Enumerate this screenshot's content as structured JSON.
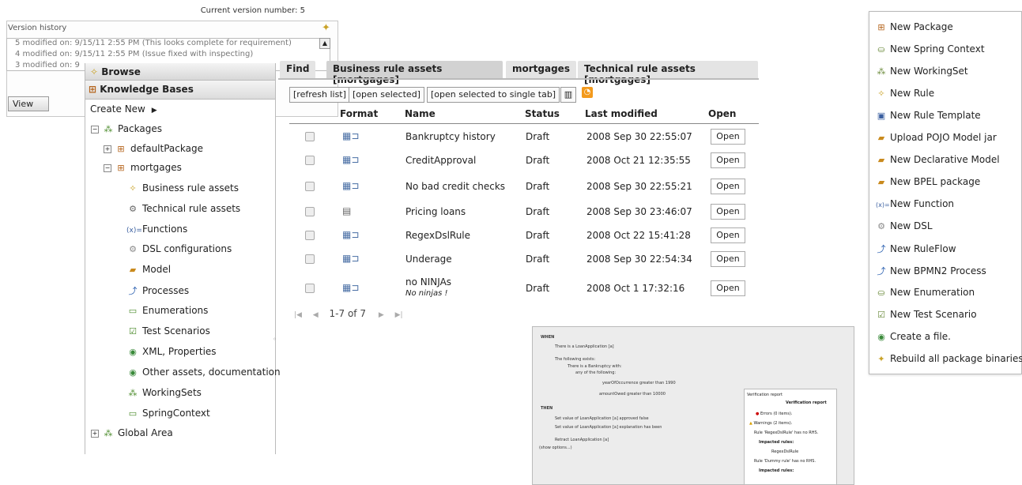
{
  "version_history": {
    "current_label": "Current version number: 5",
    "legend": "Version history",
    "entries": [
      "5 modified on: 9/15/11 2:55 PM (This looks complete for requirement)",
      "4 modified on: 9/15/11 2:55 PM (Issue fixed with inspecting)",
      "3 modified on: 9"
    ],
    "view_label": "View"
  },
  "navigator": {
    "browse_label": "Browse",
    "kb_label": "Knowledge Bases",
    "create_new": "Create New",
    "tree": [
      {
        "label": "Packages"
      },
      {
        "label": "defaultPackage"
      },
      {
        "label": "mortgages"
      },
      {
        "label": "Business rule assets"
      },
      {
        "label": "Technical rule assets"
      },
      {
        "label": "Functions"
      },
      {
        "label": "DSL configurations"
      },
      {
        "label": "Model"
      },
      {
        "label": "Processes"
      },
      {
        "label": "Enumerations"
      },
      {
        "label": "Test Scenarios"
      },
      {
        "label": "XML, Properties"
      },
      {
        "label": "Other assets, documentation"
      },
      {
        "label": "WorkingSets"
      },
      {
        "label": "SpringContext"
      },
      {
        "label": "Global Area"
      }
    ]
  },
  "tabs": [
    {
      "label": "Find"
    },
    {
      "label": "Business rule assets [mortgages]"
    },
    {
      "label": "mortgages"
    },
    {
      "label": "Technical rule assets [mortgages]"
    }
  ],
  "toolbar": {
    "refresh": "[refresh list]",
    "open_selected": "[open selected]",
    "open_single": "[open selected to single tab]"
  },
  "table": {
    "headers": [
      "Format",
      "Name",
      "Status",
      "Last modified",
      "Open"
    ],
    "rows": [
      {
        "name": "Bankruptcy history",
        "sub": "",
        "status": "Draft",
        "modified": "2008 Sep 30 22:55:07",
        "open": "Open"
      },
      {
        "name": "CreditApproval",
        "sub": "",
        "status": "Draft",
        "modified": "2008 Oct 21 12:35:55",
        "open": "Open"
      },
      {
        "name": "No bad credit checks",
        "sub": "",
        "status": "Draft",
        "modified": "2008 Sep 30 22:55:21",
        "open": "Open"
      },
      {
        "name": "Pricing loans",
        "sub": "",
        "status": "Draft",
        "modified": "2008 Sep 30 23:46:07",
        "open": "Open"
      },
      {
        "name": "RegexDslRule",
        "sub": "",
        "status": "Draft",
        "modified": "2008 Oct 22 15:41:28",
        "open": "Open"
      },
      {
        "name": "Underage",
        "sub": "",
        "status": "Draft",
        "modified": "2008 Sep 30 22:54:34",
        "open": "Open"
      },
      {
        "name": "no NINJAs",
        "sub": "No ninjas !",
        "status": "Draft",
        "modified": "2008 Oct 1 17:32:16",
        "open": "Open"
      }
    ],
    "pager_text": "1-7 of 7"
  },
  "preview": {
    "when": "WHEN",
    "then": "THEN",
    "lines": [
      "There is a LoanApplication [a]",
      "The following exists:",
      "There is a Bankruptcy with:",
      "any of the following:",
      "yearOfOccurrence  greater than  1990",
      "amountOwed  greater than  10000",
      "Set value of LoanApplication [a]   approved   false",
      "Set value of LoanApplication [a]   explanation   has been",
      "Retract LoanApplication [a]",
      "(show options...)"
    ],
    "verification_title": "Verification report",
    "verification_header": "Verification report",
    "verification_lines": [
      "Errors (0 items).",
      "Warnings (2 items).",
      "Rule 'RegexDslRule' has no RHS.",
      "Impacted rules:",
      "RegexDslRule",
      "Rule 'Dummy rule' has no RHS.",
      "Impacted rules:"
    ]
  },
  "new_menu": [
    {
      "label": "New Package",
      "icon": "package-icon"
    },
    {
      "label": "New Spring Context",
      "icon": "spring-icon"
    },
    {
      "label": "New WorkingSet",
      "icon": "workingset-icon"
    },
    {
      "label": "New Rule",
      "icon": "rule-icon"
    },
    {
      "label": "New Rule Template",
      "icon": "template-icon"
    },
    {
      "label": "Upload POJO Model jar",
      "icon": "model-icon"
    },
    {
      "label": "New Declarative Model",
      "icon": "model-icon"
    },
    {
      "label": "New BPEL package",
      "icon": "bpel-icon"
    },
    {
      "label": "New Function",
      "icon": "function-icon"
    },
    {
      "label": "New DSL",
      "icon": "dsl-icon"
    },
    {
      "label": "New RuleFlow",
      "icon": "ruleflow-icon"
    },
    {
      "label": "New BPMN2 Process",
      "icon": "bpmn-icon"
    },
    {
      "label": "New Enumeration",
      "icon": "enum-icon"
    },
    {
      "label": "New Test Scenario",
      "icon": "test-icon"
    },
    {
      "label": "Create a file.",
      "icon": "file-icon"
    },
    {
      "label": "Rebuild all package binaries",
      "icon": "rebuild-icon"
    }
  ]
}
